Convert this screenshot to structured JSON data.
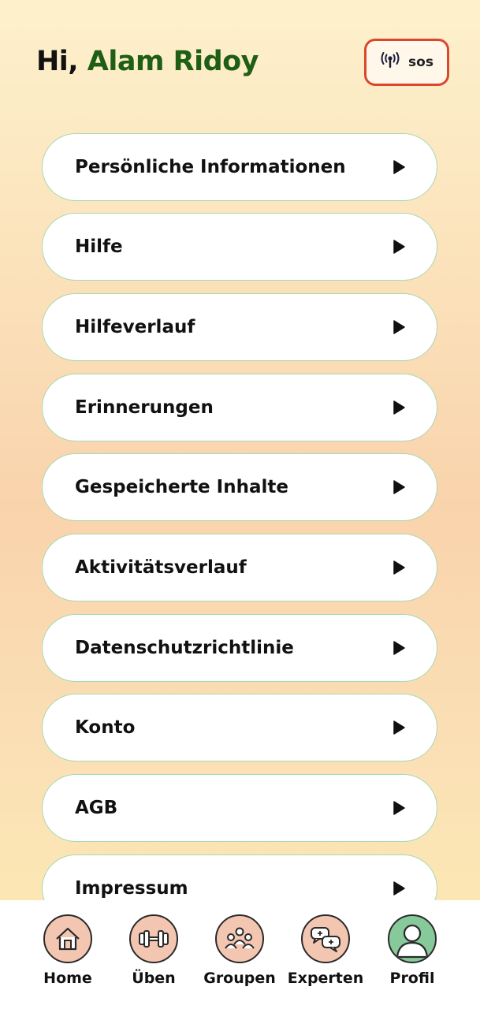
{
  "header": {
    "greeting": "Hi,",
    "user_name": "Alam Ridoy",
    "sos_label": "sos",
    "sos_icon": "broadcast-antenna-icon"
  },
  "menu": {
    "arrow_icon": "play-triangle-icon",
    "items": [
      {
        "label": "Persönliche Informationen"
      },
      {
        "label": "Hilfe"
      },
      {
        "label": "Hilfeverlauf"
      },
      {
        "label": "Erinnerungen"
      },
      {
        "label": "Gespeicherte Inhalte"
      },
      {
        "label": "Aktivitätsverlauf"
      },
      {
        "label": "Datenschutzrichtlinie"
      },
      {
        "label": "Konto"
      },
      {
        "label": "AGB"
      },
      {
        "label": "Impressum"
      }
    ]
  },
  "nav": {
    "active": "Profil",
    "items": [
      {
        "label": "Home",
        "icon": "house-icon"
      },
      {
        "label": "Üben",
        "icon": "dumbbell-icon"
      },
      {
        "label": "Groupen",
        "icon": "group-people-icon"
      },
      {
        "label": "Experten",
        "icon": "chat-bubbles-icon"
      },
      {
        "label": "Profil",
        "icon": "user-profile-icon"
      }
    ]
  },
  "colors": {
    "name_green": "#1f5e15",
    "sos_border": "#d9482e",
    "item_border": "#a8d8b2",
    "nav_icon_bg": "#f3c6b1",
    "nav_active_bg": "#86c99a"
  }
}
